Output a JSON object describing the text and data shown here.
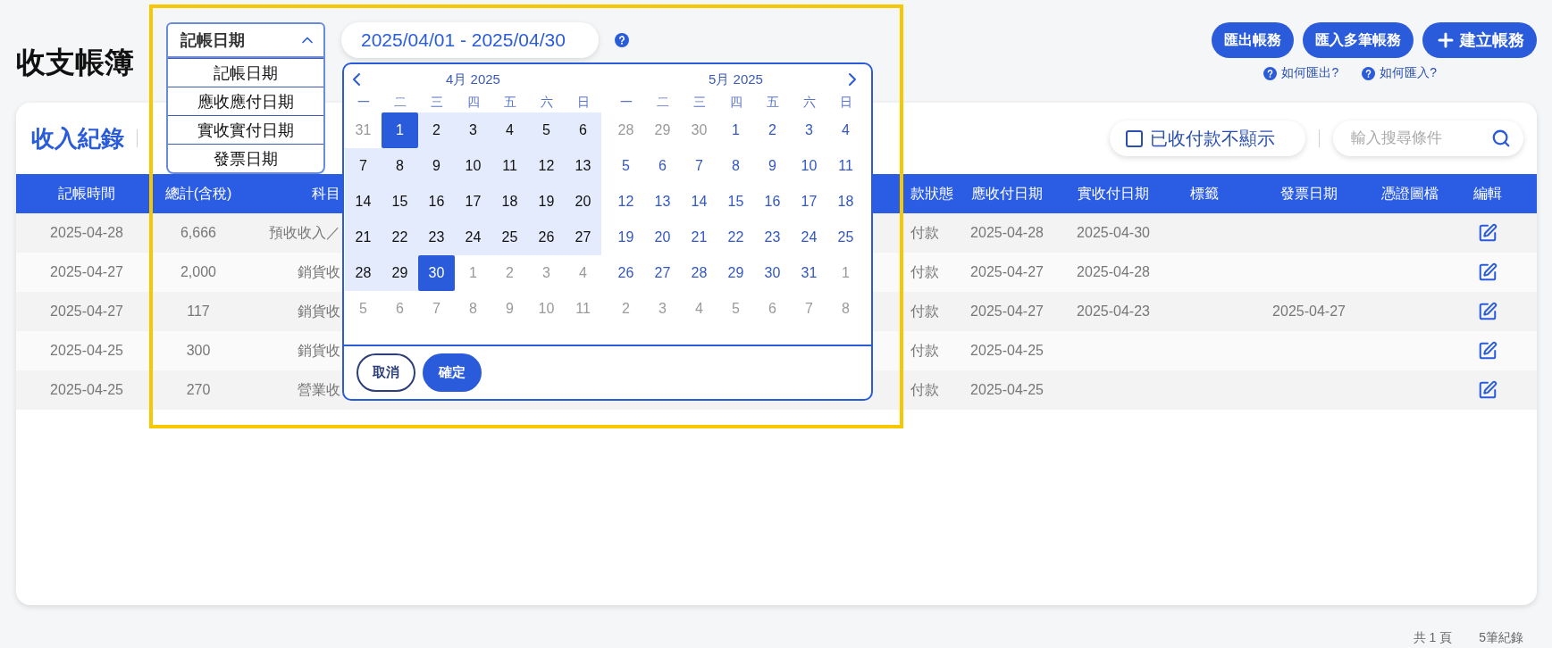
{
  "page_title": "收支帳簿",
  "date_type_select": {
    "value": "記帳日期",
    "expanded": true,
    "options": [
      "記帳日期",
      "應收應付日期",
      "實收實付日期",
      "發票日期"
    ]
  },
  "date_range": {
    "value": "2025/04/01 - 2025/04/30"
  },
  "calendar": {
    "months": [
      {
        "title": "4月 2025",
        "weekdays": [
          "一",
          "二",
          "三",
          "四",
          "五",
          "六",
          "日"
        ],
        "weeks": [
          [
            {
              "d": "31",
              "muted": true,
              "in_range": false,
              "selected": false
            },
            {
              "d": "1",
              "muted": false,
              "in_range": true,
              "selected": true
            },
            {
              "d": "2",
              "muted": false,
              "in_range": true,
              "selected": false
            },
            {
              "d": "3",
              "muted": false,
              "in_range": true,
              "selected": false
            },
            {
              "d": "4",
              "muted": false,
              "in_range": true,
              "selected": false
            },
            {
              "d": "5",
              "muted": false,
              "in_range": true,
              "selected": false
            },
            {
              "d": "6",
              "muted": false,
              "in_range": true,
              "selected": false
            }
          ],
          [
            {
              "d": "7",
              "muted": false,
              "in_range": true,
              "selected": false
            },
            {
              "d": "8",
              "muted": false,
              "in_range": true,
              "selected": false
            },
            {
              "d": "9",
              "muted": false,
              "in_range": true,
              "selected": false
            },
            {
              "d": "10",
              "muted": false,
              "in_range": true,
              "selected": false
            },
            {
              "d": "11",
              "muted": false,
              "in_range": true,
              "selected": false
            },
            {
              "d": "12",
              "muted": false,
              "in_range": true,
              "selected": false
            },
            {
              "d": "13",
              "muted": false,
              "in_range": true,
              "selected": false
            }
          ],
          [
            {
              "d": "14",
              "muted": false,
              "in_range": true,
              "selected": false
            },
            {
              "d": "15",
              "muted": false,
              "in_range": true,
              "selected": false
            },
            {
              "d": "16",
              "muted": false,
              "in_range": true,
              "selected": false
            },
            {
              "d": "17",
              "muted": false,
              "in_range": true,
              "selected": false
            },
            {
              "d": "18",
              "muted": false,
              "in_range": true,
              "selected": false
            },
            {
              "d": "19",
              "muted": false,
              "in_range": true,
              "selected": false
            },
            {
              "d": "20",
              "muted": false,
              "in_range": true,
              "selected": false
            }
          ],
          [
            {
              "d": "21",
              "muted": false,
              "in_range": true,
              "selected": false
            },
            {
              "d": "22",
              "muted": false,
              "in_range": true,
              "selected": false
            },
            {
              "d": "23",
              "muted": false,
              "in_range": true,
              "selected": false
            },
            {
              "d": "24",
              "muted": false,
              "in_range": true,
              "selected": false
            },
            {
              "d": "25",
              "muted": false,
              "in_range": true,
              "selected": false
            },
            {
              "d": "26",
              "muted": false,
              "in_range": true,
              "selected": false
            },
            {
              "d": "27",
              "muted": false,
              "in_range": true,
              "selected": false
            }
          ],
          [
            {
              "d": "28",
              "muted": false,
              "in_range": true,
              "selected": false
            },
            {
              "d": "29",
              "muted": false,
              "in_range": true,
              "selected": false
            },
            {
              "d": "30",
              "muted": false,
              "in_range": true,
              "selected": true
            },
            {
              "d": "1",
              "muted": true,
              "in_range": false,
              "selected": false
            },
            {
              "d": "2",
              "muted": true,
              "in_range": false,
              "selected": false
            },
            {
              "d": "3",
              "muted": true,
              "in_range": false,
              "selected": false
            },
            {
              "d": "4",
              "muted": true,
              "in_range": false,
              "selected": false
            }
          ],
          [
            {
              "d": "5",
              "muted": true,
              "in_range": false,
              "selected": false
            },
            {
              "d": "6",
              "muted": true,
              "in_range": false,
              "selected": false
            },
            {
              "d": "7",
              "muted": true,
              "in_range": false,
              "selected": false
            },
            {
              "d": "8",
              "muted": true,
              "in_range": false,
              "selected": false
            },
            {
              "d": "9",
              "muted": true,
              "in_range": false,
              "selected": false
            },
            {
              "d": "10",
              "muted": true,
              "in_range": false,
              "selected": false
            },
            {
              "d": "11",
              "muted": true,
              "in_range": false,
              "selected": false
            }
          ]
        ]
      },
      {
        "title": "5月 2025",
        "weekdays": [
          "一",
          "二",
          "三",
          "四",
          "五",
          "六",
          "日"
        ],
        "weeks": [
          [
            {
              "d": "28",
              "muted": true,
              "in_range": false,
              "selected": false
            },
            {
              "d": "29",
              "muted": true,
              "in_range": false,
              "selected": false
            },
            {
              "d": "30",
              "muted": true,
              "in_range": false,
              "selected": false
            },
            {
              "d": "1",
              "muted": false,
              "in_range": false,
              "selected": false
            },
            {
              "d": "2",
              "muted": false,
              "in_range": false,
              "selected": false
            },
            {
              "d": "3",
              "muted": false,
              "in_range": false,
              "selected": false
            },
            {
              "d": "4",
              "muted": false,
              "in_range": false,
              "selected": false
            }
          ],
          [
            {
              "d": "5",
              "muted": false,
              "in_range": false,
              "selected": false
            },
            {
              "d": "6",
              "muted": false,
              "in_range": false,
              "selected": false
            },
            {
              "d": "7",
              "muted": false,
              "in_range": false,
              "selected": false
            },
            {
              "d": "8",
              "muted": false,
              "in_range": false,
              "selected": false
            },
            {
              "d": "9",
              "muted": false,
              "in_range": false,
              "selected": false
            },
            {
              "d": "10",
              "muted": false,
              "in_range": false,
              "selected": false
            },
            {
              "d": "11",
              "muted": false,
              "in_range": false,
              "selected": false
            }
          ],
          [
            {
              "d": "12",
              "muted": false,
              "in_range": false,
              "selected": false
            },
            {
              "d": "13",
              "muted": false,
              "in_range": false,
              "selected": false
            },
            {
              "d": "14",
              "muted": false,
              "in_range": false,
              "selected": false
            },
            {
              "d": "15",
              "muted": false,
              "in_range": false,
              "selected": false
            },
            {
              "d": "16",
              "muted": false,
              "in_range": false,
              "selected": false
            },
            {
              "d": "17",
              "muted": false,
              "in_range": false,
              "selected": false
            },
            {
              "d": "18",
              "muted": false,
              "in_range": false,
              "selected": false
            }
          ],
          [
            {
              "d": "19",
              "muted": false,
              "in_range": false,
              "selected": false
            },
            {
              "d": "20",
              "muted": false,
              "in_range": false,
              "selected": false
            },
            {
              "d": "21",
              "muted": false,
              "in_range": false,
              "selected": false
            },
            {
              "d": "22",
              "muted": false,
              "in_range": false,
              "selected": false
            },
            {
              "d": "23",
              "muted": false,
              "in_range": false,
              "selected": false
            },
            {
              "d": "24",
              "muted": false,
              "in_range": false,
              "selected": false
            },
            {
              "d": "25",
              "muted": false,
              "in_range": false,
              "selected": false
            }
          ],
          [
            {
              "d": "26",
              "muted": false,
              "in_range": false,
              "selected": false
            },
            {
              "d": "27",
              "muted": false,
              "in_range": false,
              "selected": false
            },
            {
              "d": "28",
              "muted": false,
              "in_range": false,
              "selected": false
            },
            {
              "d": "29",
              "muted": false,
              "in_range": false,
              "selected": false
            },
            {
              "d": "30",
              "muted": false,
              "in_range": false,
              "selected": false
            },
            {
              "d": "31",
              "muted": false,
              "in_range": false,
              "selected": false
            },
            {
              "d": "1",
              "muted": true,
              "in_range": false,
              "selected": false
            }
          ],
          [
            {
              "d": "2",
              "muted": true,
              "in_range": false,
              "selected": false
            },
            {
              "d": "3",
              "muted": true,
              "in_range": false,
              "selected": false
            },
            {
              "d": "4",
              "muted": true,
              "in_range": false,
              "selected": false
            },
            {
              "d": "5",
              "muted": true,
              "in_range": false,
              "selected": false
            },
            {
              "d": "6",
              "muted": true,
              "in_range": false,
              "selected": false
            },
            {
              "d": "7",
              "muted": true,
              "in_range": false,
              "selected": false
            },
            {
              "d": "8",
              "muted": true,
              "in_range": false,
              "selected": false
            }
          ]
        ]
      }
    ],
    "buttons": [
      {
        "label": "取消",
        "kind": "secondary"
      },
      {
        "label": "確定",
        "kind": "primary"
      }
    ]
  },
  "actions": [
    {
      "label": "匯出帳務",
      "kind": "plain"
    },
    {
      "label": "匯入多筆帳務",
      "kind": "plain"
    },
    {
      "label": "建立帳務",
      "kind": "create"
    }
  ],
  "help_links": [
    "如何匯出?",
    "如何匯入?"
  ],
  "section_title": "收入紀錄",
  "hide_paid": {
    "label": "已收付款不顯示",
    "checked": false
  },
  "search": {
    "placeholder": "輸入搜尋條件"
  },
  "table": {
    "columns": [
      "記帳時間",
      "總計(含稅)",
      "科目",
      "款狀態",
      "應收付日期",
      "實收付日期",
      "標籤",
      "發票日期",
      "憑證圖檔",
      "編輯"
    ],
    "rows": [
      {
        "booked": "2025-04-28",
        "total": "6,666",
        "subject": "預收收入／",
        "status": "付款",
        "due": "2025-04-28",
        "paid": "2025-04-30"
      },
      {
        "booked": "2025-04-27",
        "total": "2,000",
        "subject": "銷貨收",
        "status": "付款",
        "due": "2025-04-27",
        "paid": "2025-04-28"
      },
      {
        "booked": "2025-04-27",
        "total": "117",
        "subject": "銷貨收",
        "status": "付款",
        "due": "2025-04-27",
        "paid": "2025-04-23",
        "invoice": "2025-04-27"
      },
      {
        "booked": "2025-04-25",
        "total": "300",
        "subject": "銷貨收",
        "status": "付款",
        "due": "2025-04-25"
      },
      {
        "booked": "2025-04-25",
        "total": "270",
        "subject": "營業收",
        "status": "付款",
        "due": "2025-04-25"
      }
    ]
  },
  "footer": {
    "pages": "共 1 頁",
    "records": "5筆紀錄"
  }
}
